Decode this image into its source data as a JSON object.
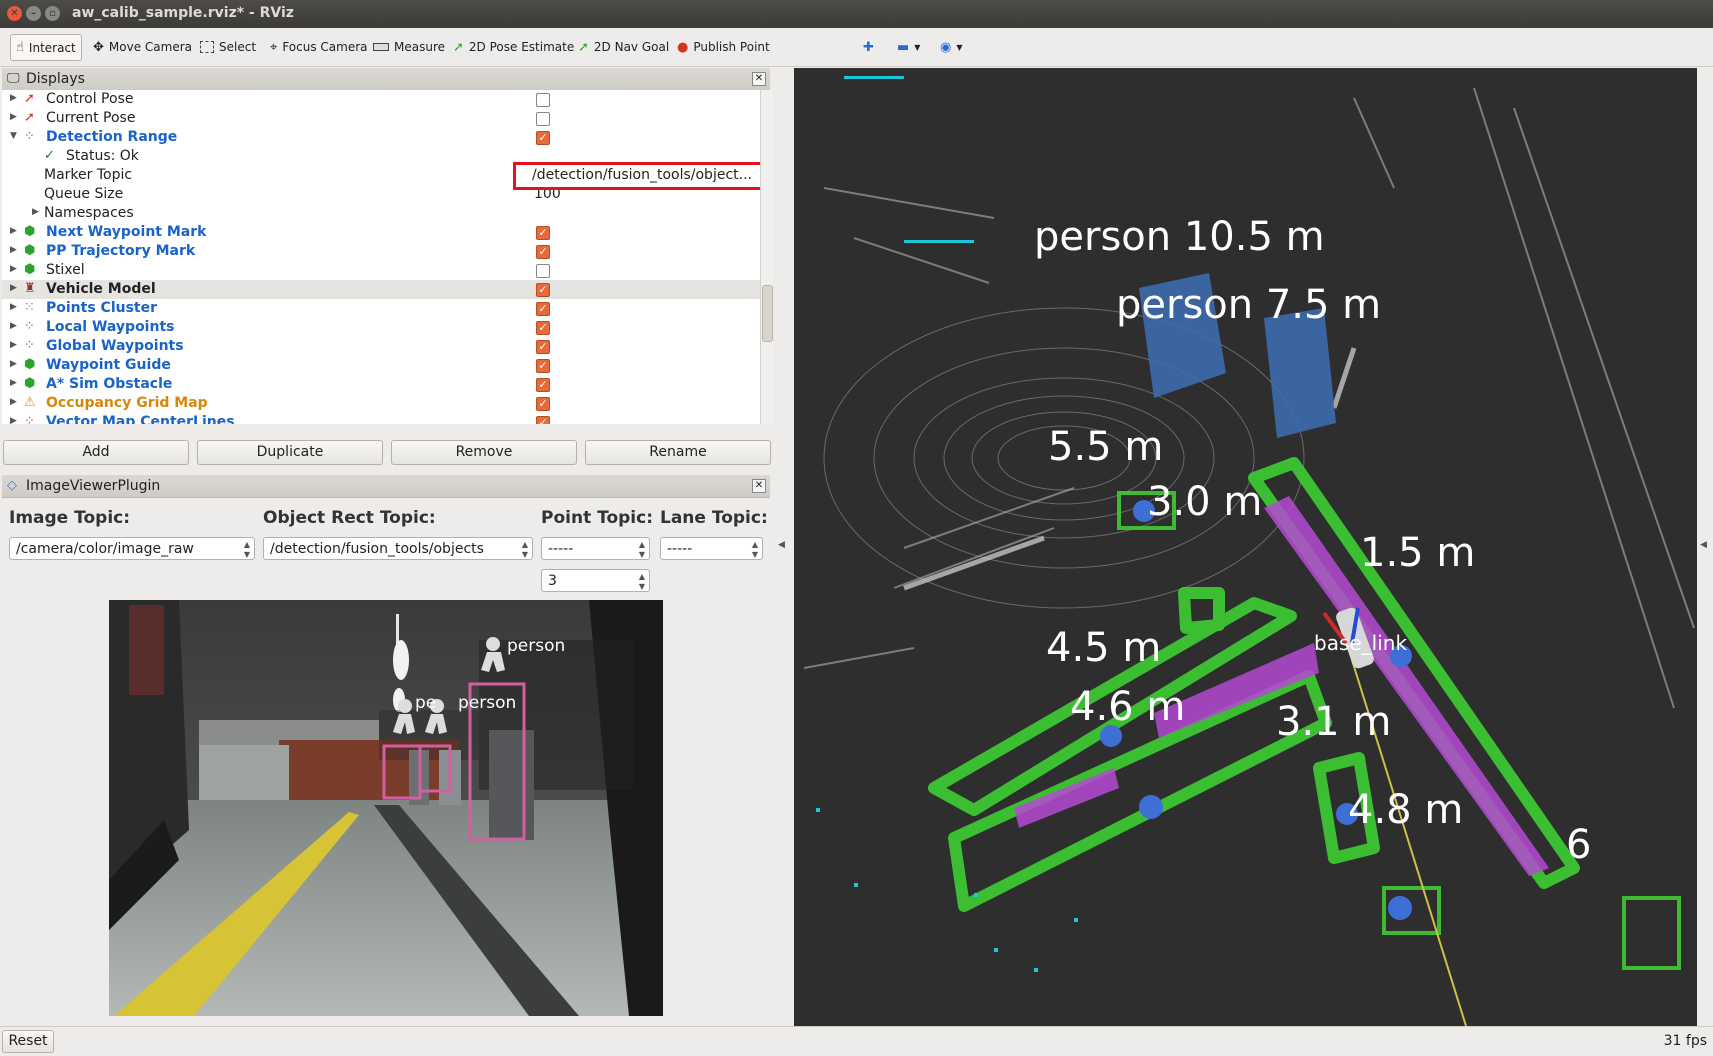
{
  "window": {
    "title": "aw_calib_sample.rviz* - RViz"
  },
  "toolbar": {
    "interact": "Interact",
    "move_camera": "Move Camera",
    "select": "Select",
    "focus_camera": "Focus Camera",
    "measure": "Measure",
    "pose_estimate": "2D Pose Estimate",
    "nav_goal": "2D Nav Goal",
    "publish_point": "Publish Point"
  },
  "displays": {
    "title": "Displays",
    "items": [
      {
        "label": "Control Pose"
      },
      {
        "label": "Current Pose"
      },
      {
        "label": "Detection Range"
      },
      {
        "label": "Status: Ok"
      },
      {
        "label": "Marker Topic",
        "value": "/detection/fusion_tools/object..."
      },
      {
        "label": "Queue Size",
        "value": "100"
      },
      {
        "label": "Namespaces"
      },
      {
        "label": "Next Waypoint Mark"
      },
      {
        "label": "PP Trajectory Mark"
      },
      {
        "label": "Stixel"
      },
      {
        "label": "Vehicle Model"
      },
      {
        "label": "Points Cluster"
      },
      {
        "label": "Local Waypoints"
      },
      {
        "label": "Global Waypoints"
      },
      {
        "label": "Waypoint Guide"
      },
      {
        "label": "A* Sim Obstacle"
      },
      {
        "label": "Occupancy Grid Map"
      },
      {
        "label": "Vector Map CenterLines"
      }
    ],
    "buttons": {
      "add": "Add",
      "duplicate": "Duplicate",
      "remove": "Remove",
      "rename": "Rename"
    }
  },
  "image_viewer": {
    "title": "ImageViewerPlugin",
    "image_topic_label": "Image Topic:",
    "image_topic_value": "/camera/color/image_raw",
    "rect_topic_label": "Object Rect Topic:",
    "rect_topic_value": "/detection/fusion_tools/objects",
    "point_topic_label": "Point Topic:",
    "point_topic_value": "-----",
    "lane_topic_label": "Lane Topic:",
    "lane_topic_value": "-----",
    "point_size": "3",
    "det_labels": [
      "person",
      "pe",
      "person"
    ]
  },
  "view3d": {
    "labels": [
      "person  10.5  m",
      "person  7.5  m",
      "5.5  m",
      "3.0  m",
      "1.5   m",
      "4.5   m",
      "4.6  m",
      "3.1  m",
      "4.8  m",
      "6"
    ],
    "frame_label": "base_link"
  },
  "status": {
    "reset": "Reset",
    "fps": "31 fps"
  },
  "colors": {
    "highlight_box": "#e5121a",
    "checkbox_on": "#e66a3c",
    "display_blue": "#1a63c9",
    "display_orange": "#d9860c"
  }
}
